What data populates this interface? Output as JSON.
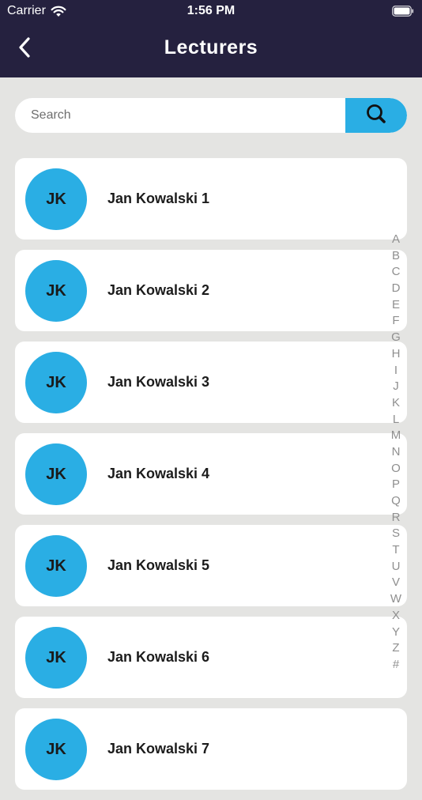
{
  "status_bar": {
    "carrier": "Carrier",
    "time": "1:56 PM"
  },
  "nav": {
    "title": "Lecturers"
  },
  "search": {
    "placeholder": "Search",
    "value": ""
  },
  "colors": {
    "header_bg": "#25213f",
    "accent": "#2aaee4",
    "page_bg": "#e4e4e2"
  },
  "icons": {
    "back": "chevron-left-icon",
    "search": "magnifier-icon",
    "wifi": "wifi-icon",
    "battery": "battery-icon"
  },
  "lecturers": [
    {
      "initials": "JK",
      "name": "Jan Kowalski 1"
    },
    {
      "initials": "JK",
      "name": "Jan Kowalski 2"
    },
    {
      "initials": "JK",
      "name": "Jan Kowalski 3"
    },
    {
      "initials": "JK",
      "name": "Jan Kowalski 4"
    },
    {
      "initials": "JK",
      "name": "Jan Kowalski 5"
    },
    {
      "initials": "JK",
      "name": "Jan Kowalski 6"
    },
    {
      "initials": "JK",
      "name": "Jan Kowalski 7"
    }
  ],
  "alphabet_index": [
    "A",
    "B",
    "C",
    "D",
    "E",
    "F",
    "G",
    "H",
    "I",
    "J",
    "K",
    "L",
    "M",
    "N",
    "O",
    "P",
    "Q",
    "R",
    "S",
    "T",
    "U",
    "V",
    "W",
    "X",
    "Y",
    "Z",
    "#"
  ]
}
